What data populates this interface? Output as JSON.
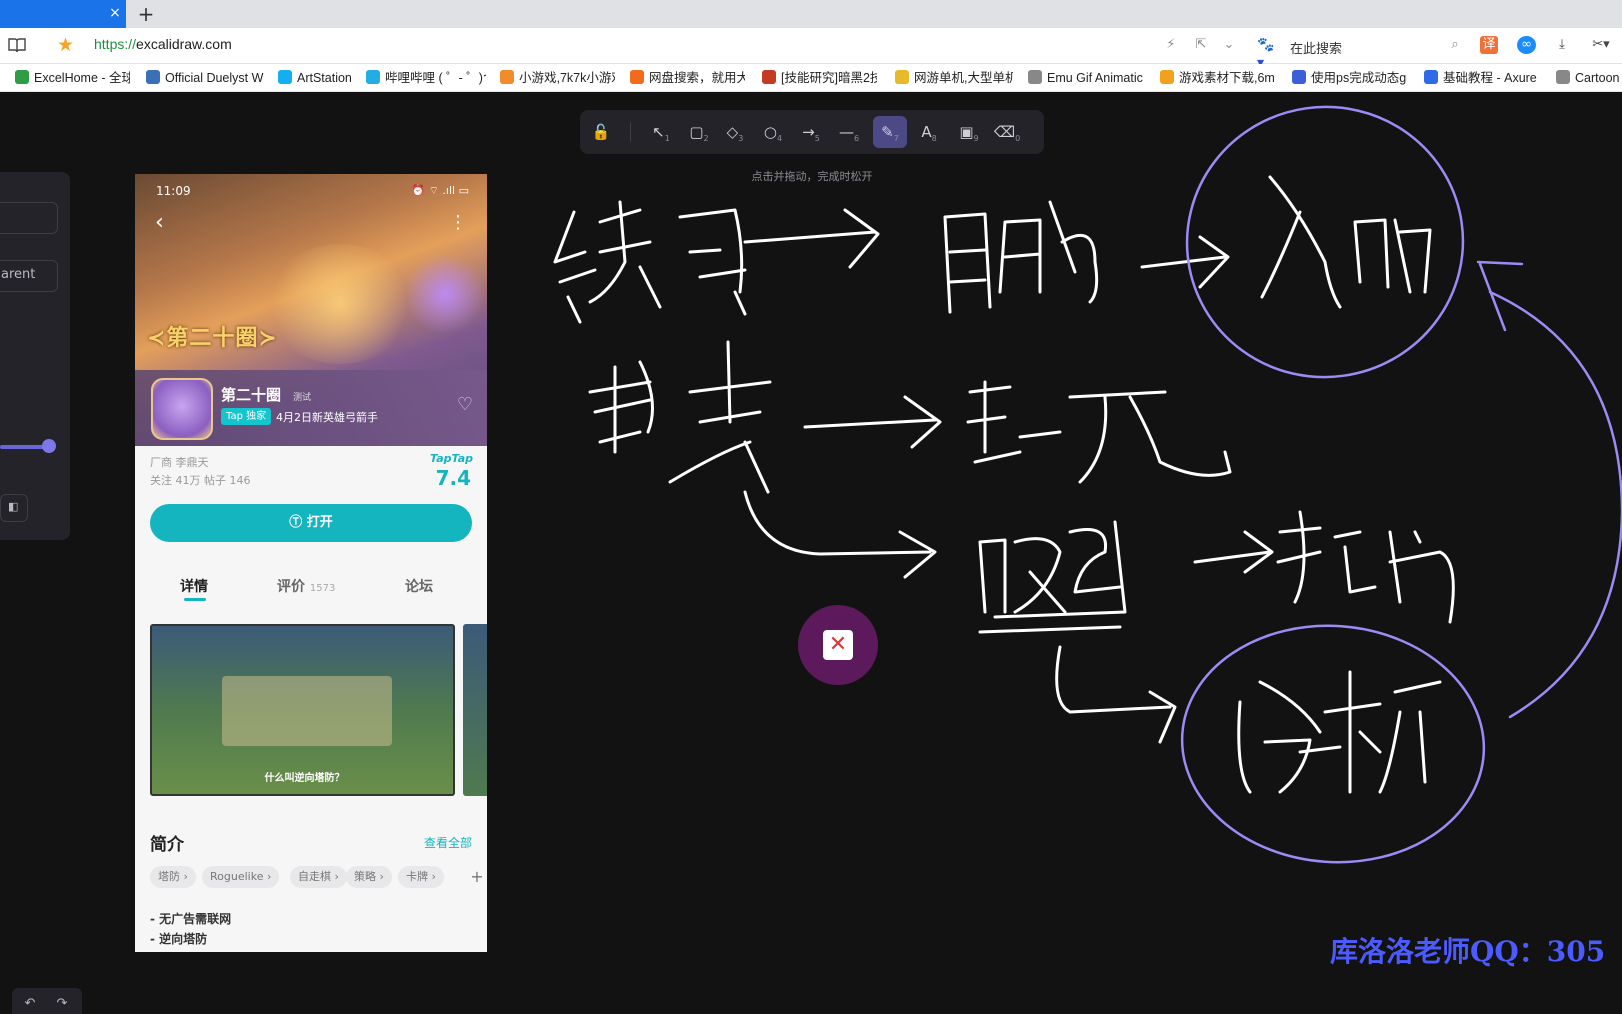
{
  "browser": {
    "tab_close": "×",
    "new_tab": "+",
    "url_scheme": "https://",
    "url_host": "excalidraw.com",
    "search_placeholder": "在此搜索",
    "bookmarks": [
      {
        "label": "ExcelHome - 全球",
        "color": "#2e9d46"
      },
      {
        "label": "Official Duelyst W",
        "color": "#3b6fb6"
      },
      {
        "label": "ArtStation",
        "color": "#13aff0"
      },
      {
        "label": "哔哩哔哩 ( ゜- ゜)つ",
        "color": "#23ade5"
      },
      {
        "label": "小游戏,7k7k小游戏",
        "color": "#f28b2b"
      },
      {
        "label": "网盘搜索，就用大",
        "color": "#f26b1d"
      },
      {
        "label": "[技能研究]暗黑2技",
        "color": "#c23b22"
      },
      {
        "label": "网游单机,大型单机",
        "color": "#e8b92a"
      },
      {
        "label": "Emu Gif Animatic",
        "color": "#888888"
      },
      {
        "label": "游戏素材下载,6m5",
        "color": "#f2a01e"
      },
      {
        "label": "使用ps完成动态gi",
        "color": "#3b5fd6"
      },
      {
        "label": "基础教程 - Axure",
        "color": "#2e6be6"
      },
      {
        "label": "Cartoon",
        "color": "#888888"
      }
    ]
  },
  "excalidraw": {
    "tools": [
      {
        "icon": "lock-icon",
        "glyph": "🔓",
        "key": ""
      },
      {
        "icon": "select-icon",
        "glyph": "↖",
        "key": "1"
      },
      {
        "icon": "rectangle-icon",
        "glyph": "▢",
        "key": "2"
      },
      {
        "icon": "diamond-icon",
        "glyph": "◇",
        "key": "3"
      },
      {
        "icon": "ellipse-icon",
        "glyph": "○",
        "key": "4"
      },
      {
        "icon": "arrow-icon",
        "glyph": "→",
        "key": "5"
      },
      {
        "icon": "line-icon",
        "glyph": "—",
        "key": "6"
      },
      {
        "icon": "pencil-icon",
        "glyph": "✎",
        "key": "7"
      },
      {
        "icon": "text-icon",
        "glyph": "A",
        "key": "8"
      },
      {
        "icon": "image-icon",
        "glyph": "▣",
        "key": "9"
      },
      {
        "icon": "eraser-icon",
        "glyph": "⌫",
        "key": "0"
      }
    ],
    "active_tool": "pencil",
    "hint": "点击并拖动，完成时松开",
    "props_partial_text": "arent",
    "accent_color": "#6965db",
    "stroke_color": "#ffffff",
    "circle_color": "#9b8cf5"
  },
  "phone": {
    "time": "11:09",
    "status_right": "⏰ ⌔ .ıll ▭",
    "banner_title": "≺第二十圈≻",
    "app_name": "第二十圈",
    "app_tag": "测试",
    "tap_badge": "Tap 独家",
    "app_sub": "4月2日新英雄弓箭手",
    "developer": "厂商 李鼎天",
    "stats": "关注 41万    帖子 146",
    "score_label": "TapTap",
    "score": "7.4",
    "open_button": "打开",
    "tabs": {
      "details": "详情",
      "reviews": "评价",
      "reviews_count": "1573",
      "forum": "论坛"
    },
    "shot_caption": "什么叫逆向塔防？",
    "intro_title": "简介",
    "view_all": "查看全部",
    "chips": [
      "塔防 ›",
      "Roguelike ›",
      "自走棋 ›",
      "策略 ›",
      "卡牌 ›"
    ],
    "intro_lines": [
      "- 无广告需联网",
      "- 逆向塔防"
    ]
  },
  "watermark": "库洛洛老师QQ：305",
  "undo": "↶",
  "redo": "↷"
}
